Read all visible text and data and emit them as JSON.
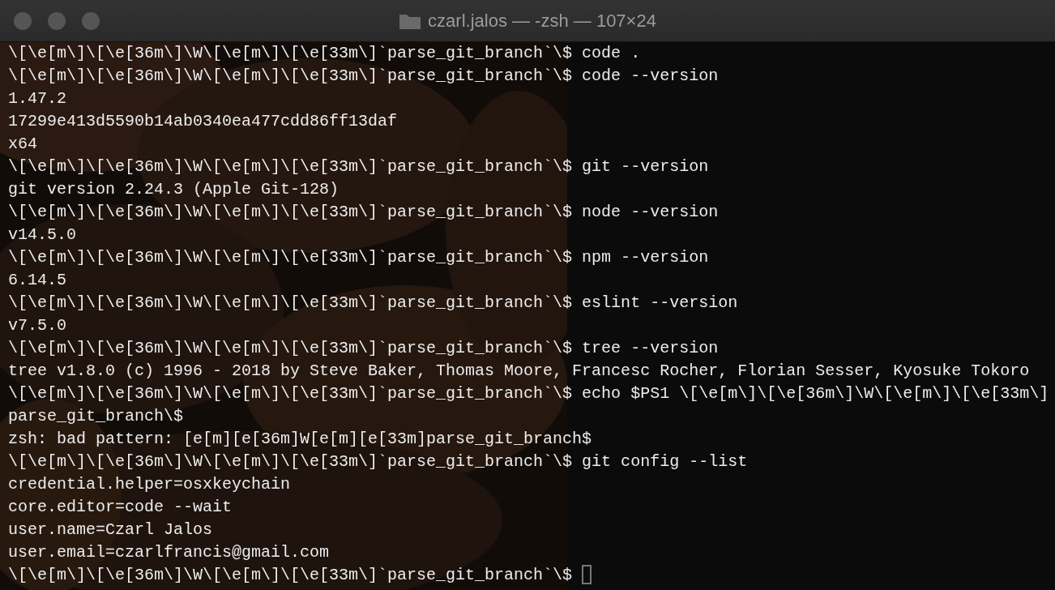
{
  "window": {
    "title": "czarl.jalos — -zsh — 107×24"
  },
  "terminal": {
    "lines": [
      {
        "kind": "prompt",
        "prompt": "\\[\\e[m\\]\\[\\e[36m\\]\\W\\[\\e[m\\]\\[\\e[33m\\]`parse_git_branch`\\$",
        "command": "code .",
        "cursor": false
      },
      {
        "kind": "prompt",
        "prompt": "\\[\\e[m\\]\\[\\e[36m\\]\\W\\[\\e[m\\]\\[\\e[33m\\]`parse_git_branch`\\$",
        "command": "code --version",
        "cursor": false
      },
      {
        "kind": "output",
        "text": "1.47.2",
        "cursor": false
      },
      {
        "kind": "output",
        "text": "17299e413d5590b14ab0340ea477cdd86ff13daf",
        "cursor": false
      },
      {
        "kind": "output",
        "text": "x64",
        "cursor": false
      },
      {
        "kind": "prompt",
        "prompt": "\\[\\e[m\\]\\[\\e[36m\\]\\W\\[\\e[m\\]\\[\\e[33m\\]`parse_git_branch`\\$",
        "command": "git --version",
        "cursor": false
      },
      {
        "kind": "output",
        "text": "git version 2.24.3 (Apple Git-128)",
        "cursor": false
      },
      {
        "kind": "prompt",
        "prompt": "\\[\\e[m\\]\\[\\e[36m\\]\\W\\[\\e[m\\]\\[\\e[33m\\]`parse_git_branch`\\$",
        "command": "node --version",
        "cursor": false
      },
      {
        "kind": "output",
        "text": "v14.5.0",
        "cursor": false
      },
      {
        "kind": "prompt",
        "prompt": "\\[\\e[m\\]\\[\\e[36m\\]\\W\\[\\e[m\\]\\[\\e[33m\\]`parse_git_branch`\\$",
        "command": "npm --version",
        "cursor": false
      },
      {
        "kind": "output",
        "text": "6.14.5",
        "cursor": false
      },
      {
        "kind": "prompt",
        "prompt": "\\[\\e[m\\]\\[\\e[36m\\]\\W\\[\\e[m\\]\\[\\e[33m\\]`parse_git_branch`\\$",
        "command": "eslint --version",
        "cursor": false
      },
      {
        "kind": "output",
        "text": "v7.5.0",
        "cursor": false
      },
      {
        "kind": "prompt",
        "prompt": "\\[\\e[m\\]\\[\\e[36m\\]\\W\\[\\e[m\\]\\[\\e[33m\\]`parse_git_branch`\\$",
        "command": "tree --version",
        "cursor": false
      },
      {
        "kind": "output",
        "text": "tree v1.8.0 (c) 1996 - 2018 by Steve Baker, Thomas Moore, Francesc Rocher, Florian Sesser, Kyosuke Tokoro",
        "cursor": false
      },
      {
        "kind": "prompt",
        "prompt": "\\[\\e[m\\]\\[\\e[36m\\]\\W\\[\\e[m\\]\\[\\e[33m\\]`parse_git_branch`\\$",
        "command": "echo $PS1 \\[\\e[m\\]\\[\\e[36m\\]\\W\\[\\e[m\\]\\[\\e[33m\\]",
        "cursor": false
      },
      {
        "kind": "output",
        "text": "parse_git_branch\\$",
        "cursor": false
      },
      {
        "kind": "output",
        "text": "zsh: bad pattern: [e[m][e[36m]W[e[m][e[33m]parse_git_branch$",
        "cursor": false
      },
      {
        "kind": "prompt",
        "prompt": "\\[\\e[m\\]\\[\\e[36m\\]\\W\\[\\e[m\\]\\[\\e[33m\\]`parse_git_branch`\\$",
        "command": "git config --list",
        "cursor": false
      },
      {
        "kind": "output",
        "text": "credential.helper=osxkeychain",
        "cursor": false
      },
      {
        "kind": "output",
        "text": "core.editor=code --wait",
        "cursor": false
      },
      {
        "kind": "output",
        "text": "user.name=Czarl Jalos",
        "cursor": false
      },
      {
        "kind": "output",
        "text": "user.email=czarlfrancis@gmail.com",
        "cursor": false
      },
      {
        "kind": "prompt",
        "prompt": "\\[\\e[m\\]\\[\\e[36m\\]\\W\\[\\e[m\\]\\[\\e[33m\\]`parse_git_branch`\\$",
        "cursor": true
      }
    ]
  }
}
